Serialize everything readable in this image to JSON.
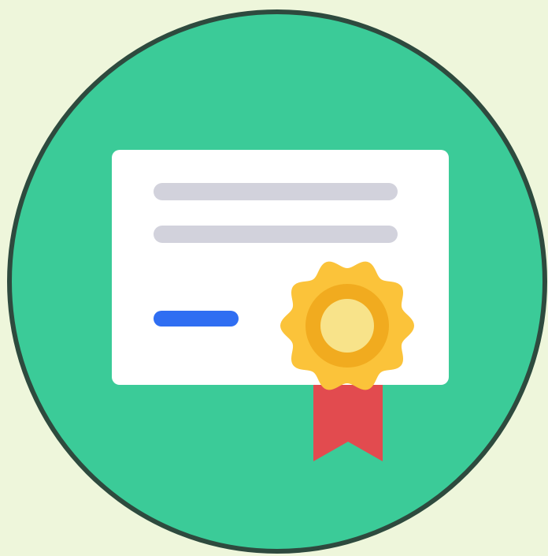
{
  "icon": {
    "name": "certificate-icon",
    "colors": {
      "page_background": "#eef6db",
      "badge_circle": "#3bcb98",
      "badge_outline": "#2e4a3e",
      "certificate_paper": "#ffffff",
      "text_placeholder_lines": "#d2d2dc",
      "signature_line": "#2f6ef2",
      "seal_outer": "#fbc33a",
      "seal_ring": "#f1ab1f",
      "seal_center": "#f8e38a",
      "ribbon": "#e24b4f"
    }
  }
}
